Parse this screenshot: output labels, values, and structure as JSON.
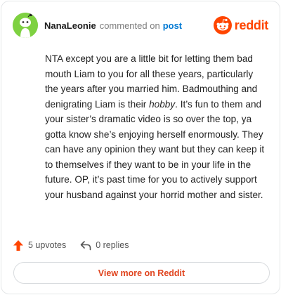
{
  "header": {
    "username": "NanaLeonie",
    "action_text": "commented on",
    "post_link": "post",
    "logo_text": "reddit"
  },
  "comment": {
    "part1": "NTA except you are a little bit for letting them bad mouth Liam to you for all these years, particularly the years after you married him. Badmouthing and denigrating Liam is their ",
    "emphasis": "hobby",
    "part2": ". It’s fun to them and your sister’s dramatic video is so over the top, ya gotta know she’s enjoying herself enormously. They can have any opinion they want but they can keep it to themselves if they want to be in your life in the future. OP, it’s past time for you to actively support your husband against your horrid mother and sister."
  },
  "actions": {
    "upvotes": "5 upvotes",
    "replies": "0 replies"
  },
  "footer": {
    "view_more": "View more on Reddit"
  },
  "colors": {
    "brand": "#ff4500",
    "avatar_bg": "#7ed141",
    "link": "#0079d3"
  },
  "icons": [
    "avatar-snoo-icon",
    "reddit-logo-icon",
    "upvote-arrow-icon",
    "reply-icon"
  ]
}
